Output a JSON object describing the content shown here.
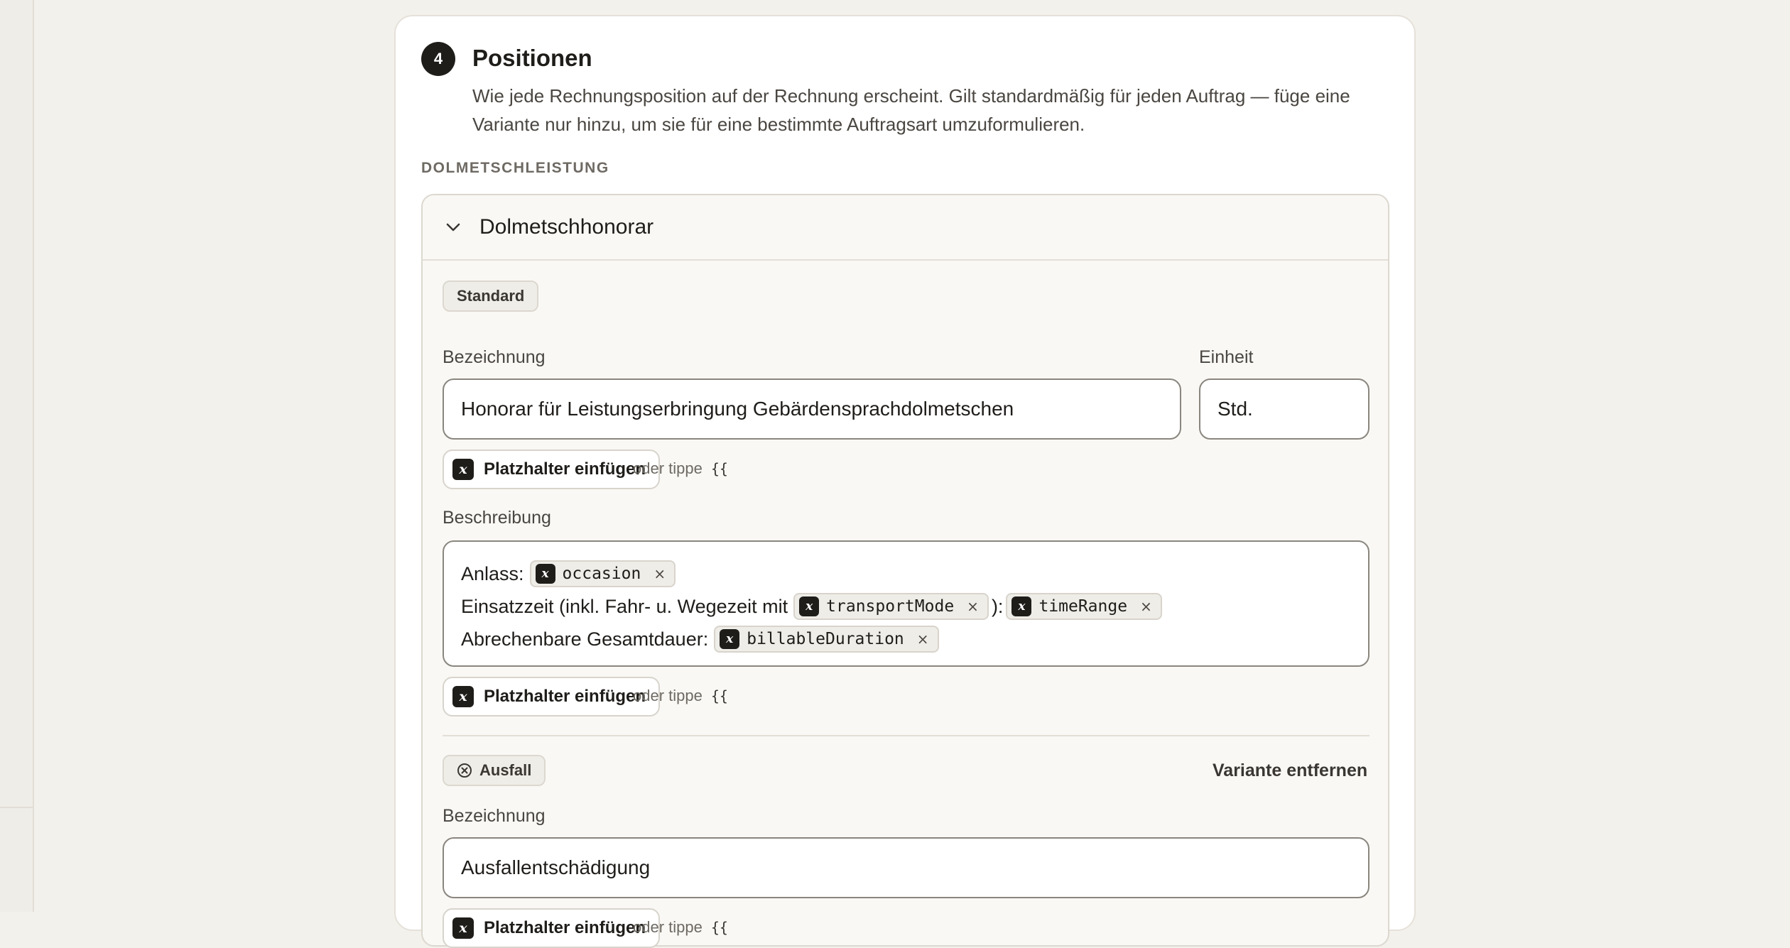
{
  "section": {
    "number": "4",
    "title": "Positionen",
    "description": "Wie jede Rechnungsposition auf der Rechnung erscheint. Gilt standardmäßig für jeden Auftrag — füge eine Variante nur hinzu, um sie für eine bestimmte Auftragsart umzuformulieren.",
    "group_label": "DOLMETSCHLEISTUNG"
  },
  "item": {
    "title": "Dolmetschhonorar",
    "default_variant": {
      "tag": "Standard",
      "bezeichnung_label": "Bezeichnung",
      "bezeichnung_value": "Honorar für Leistungserbringung Gebärdensprachdolmetschen",
      "einheit_label": "Einheit",
      "einheit_value": "Std.",
      "beschreibung_label": "Beschreibung",
      "beschreibung": {
        "line1_prefix": "Anlass:",
        "line1_chip": "occasion",
        "line2_prefix": "Einsatzzeit (inkl. Fahr- u. Wegezeit mit",
        "line2_chip1": "transportMode",
        "line2_mid": "):",
        "line2_chip2": "timeRange",
        "line3_prefix": "Abrechenbare Gesamtdauer:",
        "line3_chip": "billableDuration"
      }
    },
    "ausfall_variant": {
      "tag": "Ausfall",
      "remove_label": "Variante entfernen",
      "bezeichnung_label": "Bezeichnung",
      "bezeichnung_value": "Ausfallentschädigung"
    }
  },
  "placeholder": {
    "button_label": "Platzhalter einfügen",
    "icon_glyph": "x",
    "hint": "oder tippe",
    "hint_code": "{{",
    "chip_remove": "×"
  }
}
